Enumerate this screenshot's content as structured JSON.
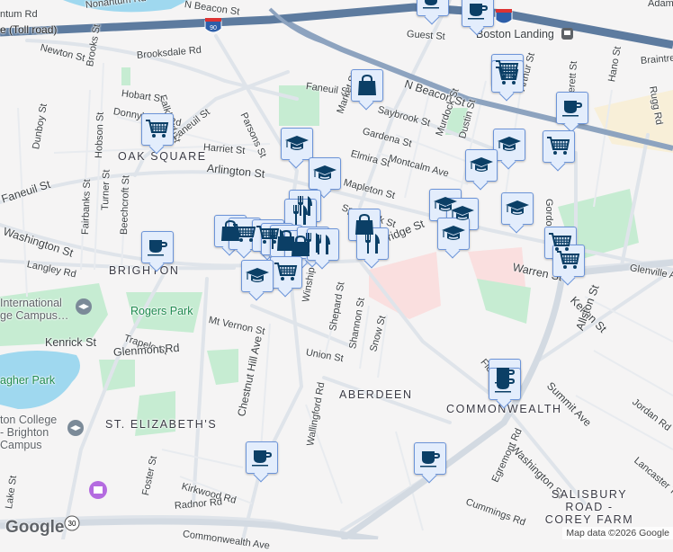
{
  "map": {
    "colors": {
      "background": "#f5f4f4",
      "highway": "#5d7b9f",
      "road": "#dfe4ea",
      "park": "#c6ecd2",
      "water": "#9fd8ef",
      "marker_fill": "#e3edfc",
      "marker_border": "#6c94d8",
      "marker_icon": "#0b3f66"
    },
    "highway_shield": "90",
    "route_shield": "30",
    "streets": [
      "Nonantum Rd",
      "N Beacon St",
      "ntum Rd",
      "e (Toll road)",
      "Newton St",
      "Brooksdale Rd",
      "Brooks St",
      "Falkland St",
      "Hobart St",
      "Donnybrook Rd",
      "Faneuil St",
      "Parsons St",
      "Faneuil St",
      "Harriet St",
      "Arlington St",
      "Faneuil St",
      "Dunboy St",
      "Hobson St",
      "Turner St",
      "Fairbanks St",
      "Beechcroft St",
      "Washington St",
      "Langley Rd",
      "Guest St",
      "N Beacon St",
      "Saybrook St",
      "Market St",
      "Gardena St",
      "Murdock St",
      "Dustin St",
      "Arthur St",
      "Montcalm Ave",
      "Elmira St",
      "Mapleton St",
      "Sparhawk St",
      "Cambridge St",
      "Everett St",
      "Hano St",
      "Braintree St",
      "Rugg Rd",
      "Gordon St",
      "Warren St",
      "Kelton St",
      "Allston St",
      "Glenville Ave",
      "Mt Vernon St",
      "Trapelo St",
      "Kenrick St",
      "Glenmont Rd",
      "Winship St",
      "Shepard St",
      "Shannon St",
      "Snow St",
      "Union St",
      "Chestnut Hill Ave",
      "Wallingford Rd",
      "Summit Ave",
      "Washington St",
      "Jordan Rd",
      "Lancaster Ter",
      "Egremont Rd",
      "Cummings Rd",
      "Foster St",
      "Kirkwood Rd",
      "Radnor Rd",
      "Lake St",
      "Commonwealth Ave",
      "Fidelis Way",
      "Adams St"
    ],
    "neighborhoods": [
      "OAK SQUARE",
      "BRIGHTON",
      "ABERDEEN",
      "COMMONWEALTH",
      "ST. ELIZABETH'S",
      "SALISBURY ROAD - COREY FARM"
    ],
    "parks": [
      "Rogers Park",
      "Chandler Pond / Gallagher Park"
    ],
    "park_label": "Rogers Park",
    "park_label2": "agher Park",
    "transit": "Boston Landing",
    "pois": {
      "intl": "International\nge Campus…",
      "bc": "ton College\n- Brighton\nCampus"
    },
    "markers": [
      "coffee",
      "cart",
      "graduation",
      "restaurant",
      "shopping-bag"
    ]
  },
  "footer": {
    "attribution": "Map data ©2026 Google",
    "logo": "Google"
  }
}
